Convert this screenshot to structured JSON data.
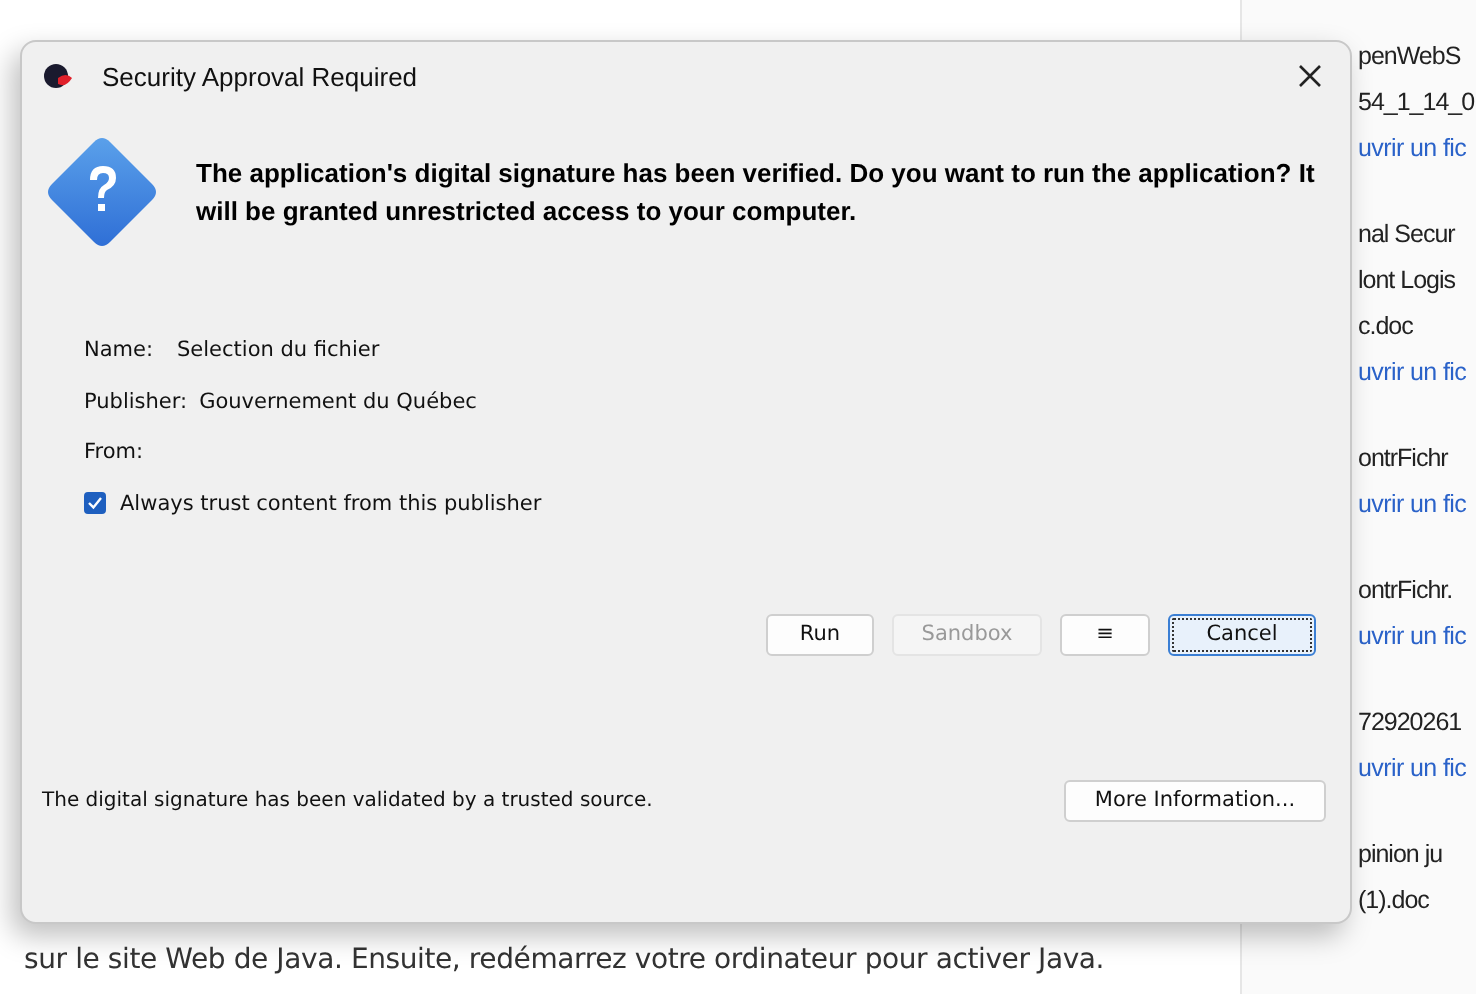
{
  "page": {
    "note_line": "sur le site Web de Java. Ensuite, redémarrez votre ordinateur pour activer Java.",
    "downloads": [
      {
        "lines": [
          "penWebS",
          "54_1_14_0"
        ],
        "link": "uvrir un fic"
      },
      {
        "lines": [
          "nal Secur",
          "lont Logis",
          "c.doc"
        ],
        "link": "uvrir un fic"
      },
      {
        "lines": [
          "ontrFichr"
        ],
        "link": "uvrir un fic"
      },
      {
        "lines": [
          "ontrFichr."
        ],
        "link": "uvrir un fic"
      },
      {
        "lines": [
          "72920261"
        ],
        "link": "uvrir un fic"
      },
      {
        "lines": [
          "pinion ju",
          "(1).doc"
        ]
      }
    ]
  },
  "dialog": {
    "title": "Security Approval Required",
    "heading": "The application's digital signature has been verified. Do you want to run the application? It will be granted unrestricted access to your computer.",
    "fields": [
      {
        "label": "Name:",
        "value": "Selection du fichier"
      },
      {
        "label": "Publisher:",
        "value": "Gouvernement du Québec"
      },
      {
        "label": "From:"
      }
    ],
    "trust": {
      "label": "Always trust content from this publisher",
      "checked": true
    },
    "buttons": [
      {
        "label": "Run",
        "disabled": false,
        "focused": false
      },
      {
        "label": "Sandbox",
        "disabled": true,
        "focused": false
      },
      {
        "label": "≡",
        "disabled": false,
        "focused": false
      },
      {
        "label": "Cancel",
        "disabled": false,
        "focused": true
      }
    ],
    "footer_text": "The digital signature has been validated by a trusted source.",
    "more_button": "More Information..."
  }
}
